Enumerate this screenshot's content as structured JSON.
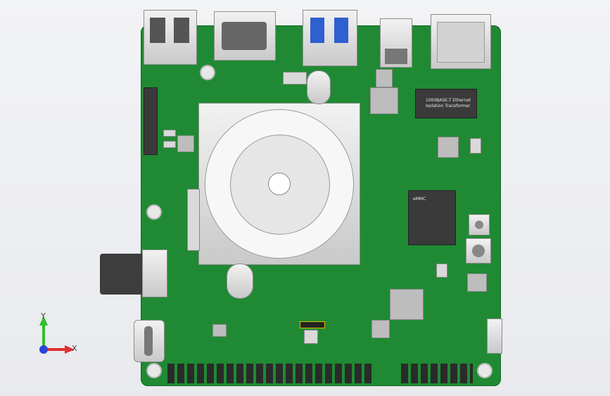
{
  "board": {
    "transformer_label_line1": "1000BASE-T Ethernet",
    "transformer_label_line2": "Isolation Transformer",
    "emmc_label": "eMMC"
  },
  "axes": {
    "y_label": "Y",
    "x_label": "X"
  },
  "colors": {
    "pcb": "#1f8a33",
    "y_axis": "#2fbf2f",
    "x_axis": "#e03030",
    "origin": "#2a44d8"
  }
}
